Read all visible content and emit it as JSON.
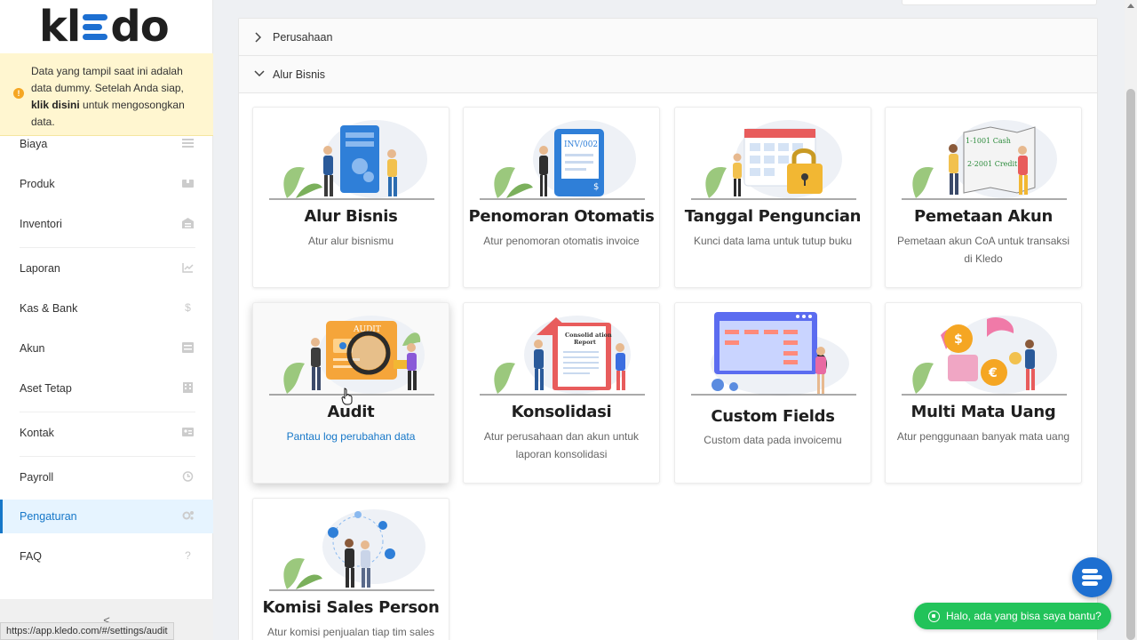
{
  "brand": {
    "logo_k": "kl",
    "logo_rest": "do"
  },
  "notice": {
    "text_before": "Data yang tampil saat ini adalah data dummy. Setelah Anda siap, ",
    "link": "klik disini",
    "text_after": " untuk mengosongkan data."
  },
  "sidebar": {
    "items": [
      {
        "label": "Biaya",
        "icon": "list-icon"
      },
      {
        "label": "Produk",
        "icon": "box-icon"
      },
      {
        "label": "Inventori",
        "icon": "warehouse-icon"
      },
      {
        "label": "Laporan",
        "icon": "chart-icon"
      },
      {
        "label": "Kas & Bank",
        "icon": "dollar-icon"
      },
      {
        "label": "Akun",
        "icon": "ledger-icon"
      },
      {
        "label": "Aset Tetap",
        "icon": "building-icon"
      },
      {
        "label": "Kontak",
        "icon": "contact-card-icon"
      },
      {
        "label": "Payroll",
        "icon": "payroll-icon"
      },
      {
        "label": "Pengaturan",
        "icon": "gear-icon",
        "active": true
      },
      {
        "label": "FAQ",
        "icon": "question-icon"
      }
    ],
    "collapse_glyph": "<"
  },
  "status_url": "https://app.kledo.com/#/settings/audit",
  "sections": [
    {
      "label": "Perusahaan",
      "expanded": false
    },
    {
      "label": "Alur Bisnis",
      "expanded": true
    }
  ],
  "cards": [
    {
      "title": "Alur Bisnis",
      "desc": "Atur alur bisnismu"
    },
    {
      "title": "Penomoran Otomatis",
      "desc": "Atur penomoran otomatis invoice",
      "illus_text": "INV/002"
    },
    {
      "title": "Tanggal Penguncian",
      "desc": "Kunci data lama untuk tutup buku"
    },
    {
      "title": "Pemetaan Akun",
      "desc": "Pemetaan akun CoA untuk transaksi di Kledo",
      "illus_text1": "1-1001 Cash",
      "illus_text2": "2-2001 Credit"
    },
    {
      "title": "Audit",
      "desc": "Pantau log perubahan data",
      "illus_text": "AUDIT",
      "hovered": true
    },
    {
      "title": "Konsolidasi",
      "desc": "Atur perusahaan dan akun untuk laporan konsolidasi",
      "illus_text1": "Consolid ation",
      "illus_text2": "Report"
    },
    {
      "title": "Custom Fields",
      "desc": "Custom data pada invoicemu"
    },
    {
      "title": "Multi Mata Uang",
      "desc": "Atur penggunaan banyak mata uang"
    },
    {
      "title": "Komisi Sales Person",
      "desc": "Atur komisi penjualan tiap tim sales"
    }
  ],
  "chat_widget": {
    "label": "Halo, ada yang bisa saya bantu?"
  },
  "colors": {
    "primary": "#1d6fd1",
    "whatsapp": "#22c35a",
    "notice_bg": "#fff6d0",
    "active_bg": "#e6f4ff"
  }
}
